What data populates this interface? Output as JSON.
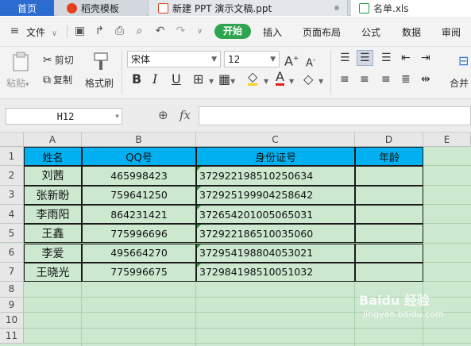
{
  "tabs": [
    {
      "label": "首页"
    },
    {
      "label": "稻壳模板"
    },
    {
      "label": "新建 PPT 演示文稿.ppt"
    },
    {
      "label": "名单.xls"
    }
  ],
  "menu": {
    "file": "文件",
    "items": [
      "开始",
      "插入",
      "页面布局",
      "公式",
      "数据",
      "审阅"
    ]
  },
  "ribbon": {
    "paste": "粘贴",
    "cut": "剪切",
    "copy": "复制",
    "format_painter": "格式刷",
    "font_name": "宋体",
    "font_size": "12",
    "merge": "合并"
  },
  "formula_bar": {
    "name_box": "H12",
    "fx": "fx"
  },
  "sheet": {
    "columns": [
      "A",
      "B",
      "C",
      "D",
      "E"
    ],
    "rows": [
      "1",
      "2",
      "3",
      "4",
      "5",
      "6",
      "7",
      "8",
      "9",
      "10",
      "11"
    ],
    "header": [
      "姓名",
      "QQ号",
      "身份证号",
      "年龄"
    ],
    "data": [
      [
        "刘茜",
        "465998423",
        "372922198510250634",
        ""
      ],
      [
        "张新盼",
        "759641250",
        "372925199904258642",
        ""
      ],
      [
        "李雨阳",
        "864231421",
        "372654201005065031",
        ""
      ],
      [
        "王鑫",
        "775996696",
        "372922186510035060",
        ""
      ],
      [
        "李爱",
        "495664270",
        "372954198804053021",
        ""
      ],
      [
        "王晓光",
        "775996675",
        "372984198510051032",
        ""
      ]
    ]
  },
  "watermark": {
    "brand": "Baidu 经验",
    "url": "jingyan.baidu.com"
  },
  "colors": {
    "header_fill": "#00b0f0",
    "sheet_bg": "#cce8cf",
    "accent": "#2ea44f"
  }
}
